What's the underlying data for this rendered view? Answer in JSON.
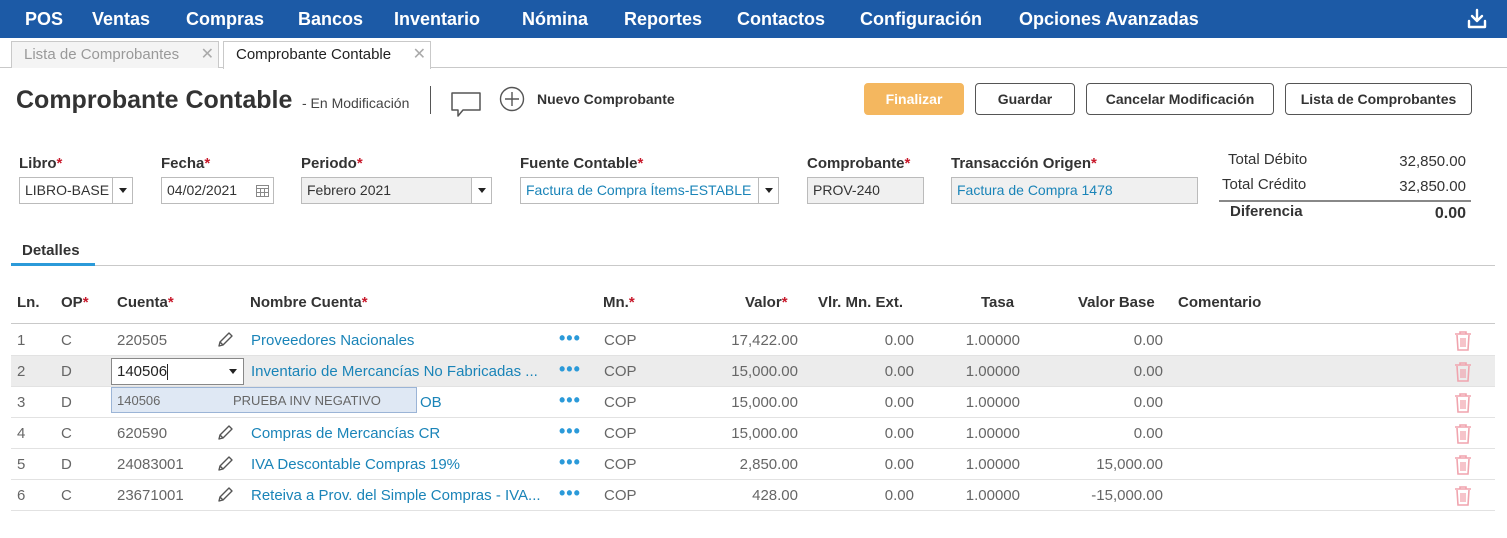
{
  "nav": {
    "items": [
      "POS",
      "Ventas",
      "Compras",
      "Bancos",
      "Inventario",
      "Nómina",
      "Reportes",
      "Contactos",
      "Configuración",
      "Opciones Avanzadas"
    ],
    "download_icon": "download-icon"
  },
  "tabs": [
    {
      "label": "Lista de Comprobantes",
      "active": false
    },
    {
      "label": "Comprobante Contable",
      "active": true
    }
  ],
  "header": {
    "title": "Comprobante Contable",
    "status": "- En Modificación",
    "new_label": "Nuevo Comprobante",
    "buttons": {
      "finalizar": "Finalizar",
      "guardar": "Guardar",
      "cancelar": "Cancelar Modificación",
      "lista": "Lista de Comprobantes"
    }
  },
  "form": {
    "libro": {
      "label": "Libro",
      "value": "LIBRO-BASE"
    },
    "fecha": {
      "label": "Fecha",
      "value": "04/02/2021"
    },
    "periodo": {
      "label": "Periodo",
      "value": "Febrero 2021"
    },
    "fuente": {
      "label": "Fuente Contable",
      "value": "Factura de Compra Ítems-ESTABLE"
    },
    "comprobante": {
      "label": "Comprobante",
      "value": "PROV-240"
    },
    "transaccion": {
      "label": "Transacción Origen",
      "value": "Factura de Compra 1478"
    },
    "required_mark": "*"
  },
  "totals": {
    "debito_label": "Total Débito",
    "debito": "32,850.00",
    "credito_label": "Total Crédito",
    "credito": "32,850.00",
    "diferencia_label": "Diferencia",
    "diferencia": "0.00"
  },
  "details_tab": "Detalles",
  "table": {
    "headers": {
      "ln": "Ln.",
      "op": "OP",
      "cuenta": "Cuenta",
      "nombre": "Nombre Cuenta",
      "mn": "Mn.",
      "valor": "Valor",
      "vlr": "Vlr. Mn. Ext.",
      "tasa": "Tasa",
      "base": "Valor Base",
      "comentario": "Comentario"
    },
    "rows": [
      {
        "ln": "1",
        "op": "C",
        "cuenta": "220505",
        "nombre": "Proveedores Nacionales",
        "mn": "COP",
        "valor": "17,422.00",
        "vlr": "0.00",
        "tasa": "1.00000",
        "base": "0.00"
      },
      {
        "ln": "2",
        "op": "D",
        "cuenta": "140506",
        "nombre": "Inventario de Mercancías No Fabricadas ...",
        "mn": "COP",
        "valor": "15,000.00",
        "vlr": "0.00",
        "tasa": "1.00000",
        "base": "0.00"
      },
      {
        "ln": "3",
        "op": "D",
        "cuenta": "",
        "nombre": "OB",
        "mn": "COP",
        "valor": "15,000.00",
        "vlr": "0.00",
        "tasa": "1.00000",
        "base": "0.00"
      },
      {
        "ln": "4",
        "op": "C",
        "cuenta": "620590",
        "nombre": "Compras de Mercancías CR",
        "mn": "COP",
        "valor": "15,000.00",
        "vlr": "0.00",
        "tasa": "1.00000",
        "base": "0.00"
      },
      {
        "ln": "5",
        "op": "D",
        "cuenta": "24083001",
        "nombre": "IVA Descontable Compras 19%",
        "mn": "COP",
        "valor": "2,850.00",
        "vlr": "0.00",
        "tasa": "1.00000",
        "base": "15,000.00"
      },
      {
        "ln": "6",
        "op": "C",
        "cuenta": "23671001",
        "nombre": "Reteiva a Prov. del Simple Compras - IVA...",
        "mn": "COP",
        "valor": "428.00",
        "vlr": "0.00",
        "tasa": "1.00000",
        "base": "-15,000.00"
      }
    ],
    "dots": "•••"
  },
  "autocomplete": {
    "input_value": "140506",
    "option_code": "140506",
    "option_name": "PRUEBA INV NEGATIVO"
  }
}
